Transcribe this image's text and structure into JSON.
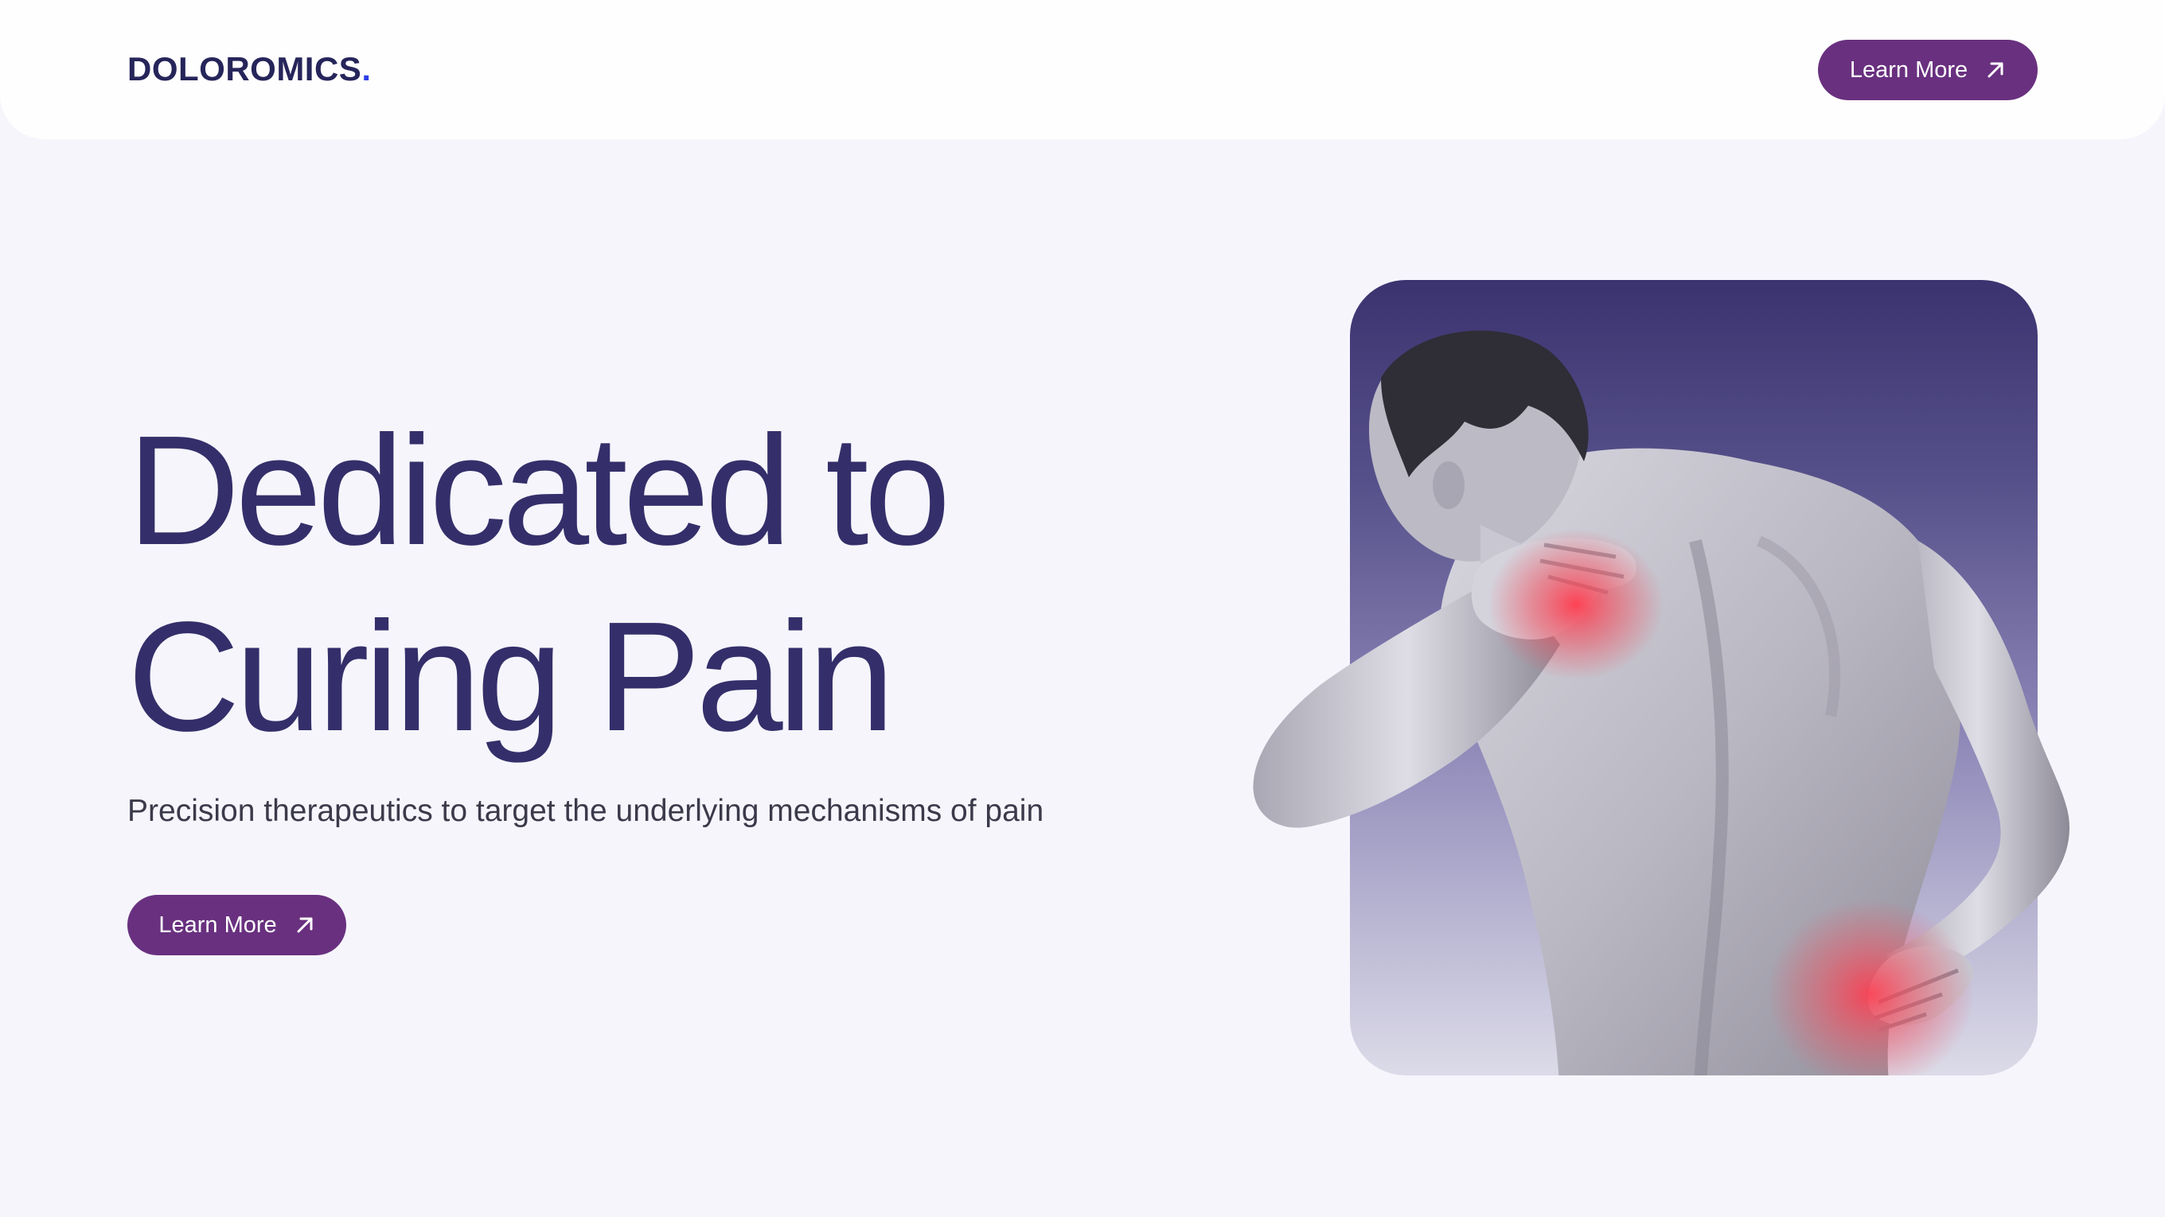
{
  "header": {
    "logo_text": "DOLOROMICS",
    "logo_dot": ".",
    "cta_label": "Learn More",
    "cta_icon": "arrow-up-right-icon"
  },
  "hero": {
    "title_line1": "Dedicated to",
    "title_line2": "Curing Pain",
    "subtitle": "Precision therapeutics to target the underlying mechanisms of pain",
    "cta_label": "Learn More",
    "cta_icon": "arrow-up-right-icon",
    "image_subject": "man holding neck and lower back with red pain highlights"
  },
  "colors": {
    "background": "#f6f5fc",
    "brand_dark": "#342f6a",
    "button": "#69307f",
    "logo_dot": "#2e3ee6",
    "pain_highlight": "#e84a5a"
  }
}
